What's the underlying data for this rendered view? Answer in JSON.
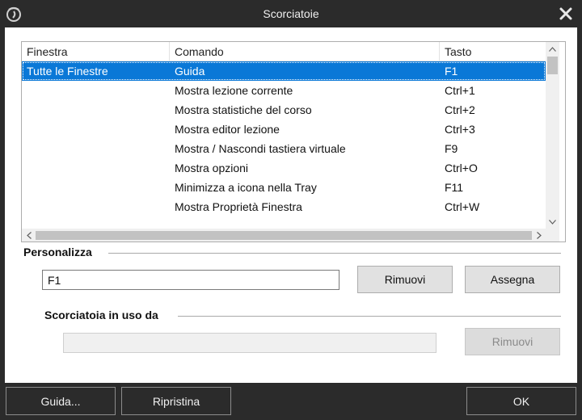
{
  "window": {
    "title": "Scorciatoie",
    "icon": "app-logo-icon",
    "close_icon": "close-icon"
  },
  "list": {
    "columns": [
      "Finestra",
      "Comando",
      "Tasto"
    ],
    "rows": [
      {
        "window": "Tutte le Finestre",
        "command": "Guida",
        "key": "F1",
        "selected": true
      },
      {
        "window": "",
        "command": "Mostra lezione corrente",
        "key": "Ctrl+1"
      },
      {
        "window": "",
        "command": "Mostra statistiche del corso",
        "key": "Ctrl+2"
      },
      {
        "window": "",
        "command": "Mostra editor lezione",
        "key": "Ctrl+3"
      },
      {
        "window": "",
        "command": "Mostra / Nascondi tastiera virtuale",
        "key": "F9"
      },
      {
        "window": "",
        "command": "Mostra opzioni",
        "key": "Ctrl+O"
      },
      {
        "window": "",
        "command": "Minimizza a icona nella Tray",
        "key": "F11"
      },
      {
        "window": "",
        "command": "Mostra Proprietà Finestra",
        "key": "Ctrl+W"
      }
    ]
  },
  "customize": {
    "label": "Personalizza",
    "key_value": "F1",
    "remove_label": "Rimuovi",
    "assign_label": "Assegna"
  },
  "in_use": {
    "label": "Scorciatoia in uso da",
    "value": "",
    "remove_label": "Rimuovi"
  },
  "footer": {
    "help_label": "Guida...",
    "reset_label": "Ripristina",
    "ok_label": "OK"
  },
  "colors": {
    "titlebar": "#2b2b2b",
    "selection": "#0a78d7",
    "button_face": "#e1e1e1"
  }
}
